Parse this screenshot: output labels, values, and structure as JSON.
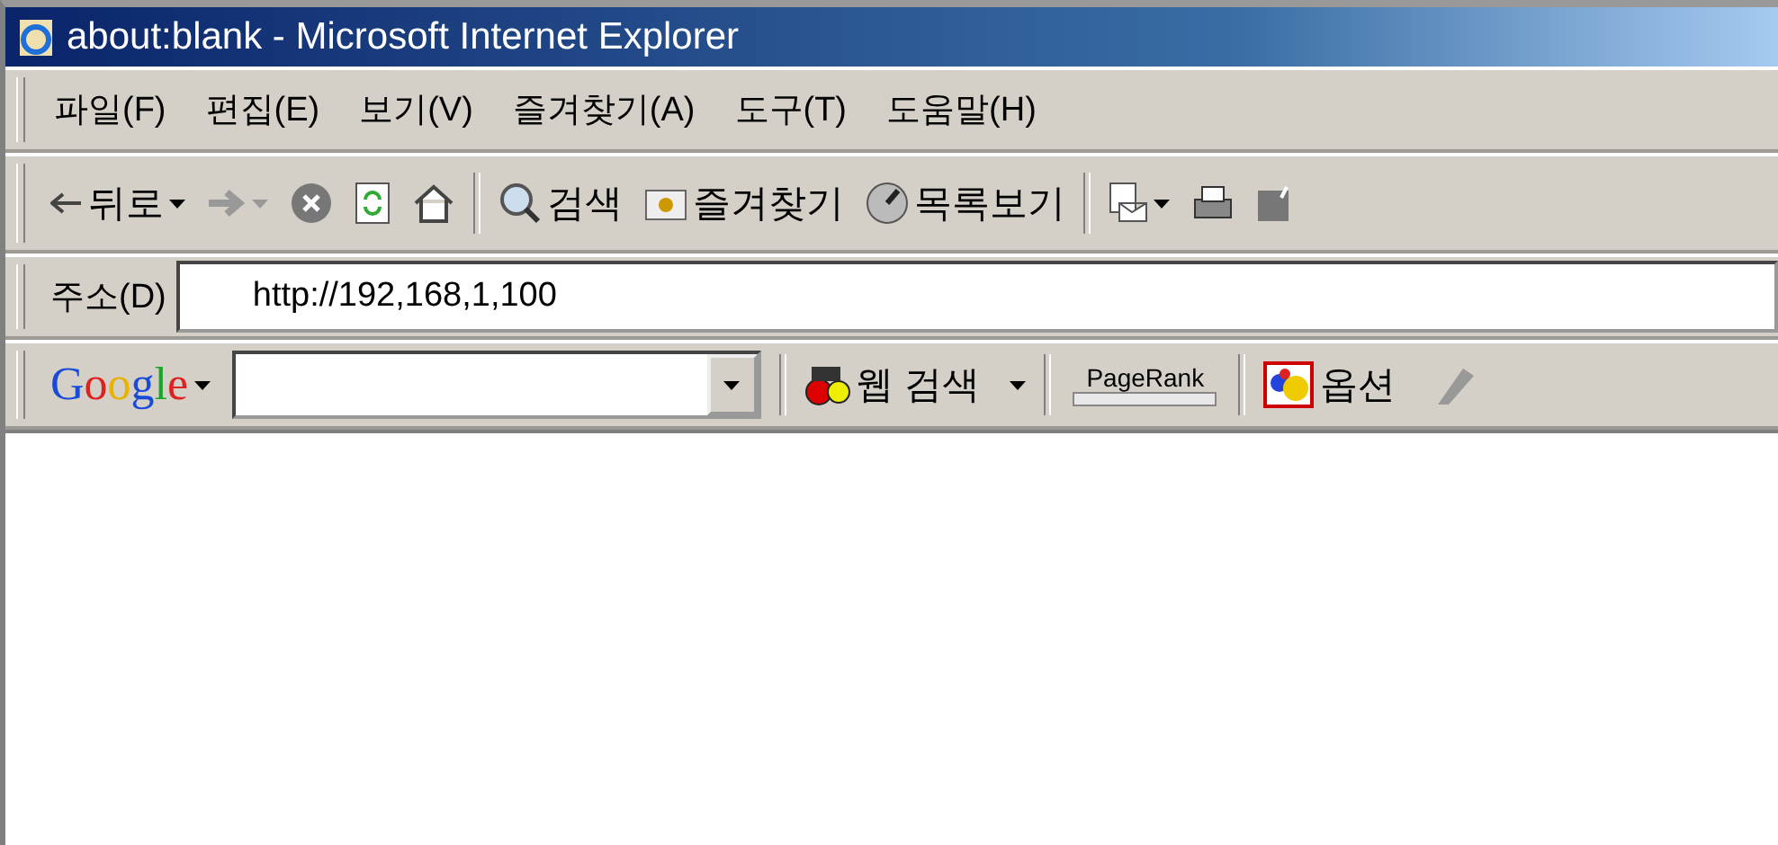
{
  "window": {
    "title": "about:blank - Microsoft Internet Explorer"
  },
  "menu": [
    {
      "label": "파일(F)"
    },
    {
      "label": "편집(E)"
    },
    {
      "label": "보기(V)"
    },
    {
      "label": "즐겨찾기(A)"
    },
    {
      "label": "도구(T)"
    },
    {
      "label": "도움말(H)"
    }
  ],
  "toolbar": [
    {
      "kind": "back",
      "label": "뒤로",
      "dropdown": true,
      "disabled": false
    },
    {
      "kind": "forward",
      "dropdown": true,
      "disabled": true
    },
    {
      "kind": "stop"
    },
    {
      "kind": "refresh"
    },
    {
      "kind": "home"
    },
    {
      "kind": "sep"
    },
    {
      "kind": "search",
      "label": "검색"
    },
    {
      "kind": "favorites",
      "label": "즐겨찾기"
    },
    {
      "kind": "history",
      "label": "목록보기"
    },
    {
      "kind": "sep"
    },
    {
      "kind": "mail",
      "dropdown": true
    },
    {
      "kind": "print"
    },
    {
      "kind": "edit"
    }
  ],
  "address": {
    "label": "주소(D)",
    "value": "http://192,168,1,100"
  },
  "google_bar": {
    "logo": "Google",
    "search_button": "웹 검색",
    "pagerank": {
      "label": "PageRank",
      "level": 0
    },
    "options": "옵션"
  }
}
